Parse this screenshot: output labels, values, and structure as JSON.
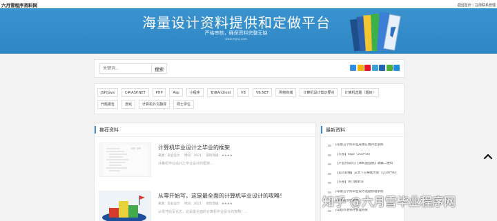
{
  "topbar": {
    "logo": "六月雪程序资料网",
    "links": [
      "返回首页",
      "在线联系管理"
    ]
  },
  "banner": {
    "title": "海量设计资料提供和定做平台",
    "subtitle": "严格审核，确保资料完整无缺",
    "url": "www.mylxj.com"
  },
  "search": {
    "placeholder": "关键词...",
    "button": "搜索"
  },
  "share_icons": [
    "plus-icon",
    "qzone-icon",
    "weibo-icon",
    "tencent-weibo-icon",
    "renren-icon",
    "wechat-icon",
    "qq-icon"
  ],
  "tags": [
    "JSP/Java",
    "C#/ASP.NET",
    "PHP",
    "Asp",
    "小程序",
    "安卓Android",
    "VB",
    "VB.NET",
    "购物商城",
    "计算机设计知识要点",
    "计算机选题（题目）",
    "开题报告",
    "游戏",
    "计算机外文翻译",
    "硕士学位"
  ],
  "recommend": {
    "title": "推荐资料",
    "articles": [
      {
        "title": "计算机毕业设计之毕业的框架",
        "meta": [
          "来源：毕业设计",
          "时间：2021",
          "资料等级：★★★★"
        ],
        "desc": "计算机毕业设计之毕业设计的框架..."
      },
      {
        "title": "从零开始写，这是最全面的计算机毕业设计的攻略！",
        "meta": [
          "来源：毕业设计",
          "时间：2021",
          "资料等级：★★★★"
        ],
        "desc": "从零开始写论文，这是最全面的计算机毕业设计的攻略！..."
      }
    ]
  },
  "latest": {
    "title": "最新资料",
    "items": [
      "jsp留言学院毕业成绩在线评定系统",
      "【头部】logo（250*50）",
      "【产品内容页】【本机画面图】收藏二维码",
      "【首页轮播】正文下方横幅大图（1100*90）",
      "【头部】热门搜索词",
      "jsp留言学院毕业设计选题管理系统",
      "jsp会员管理系统",
      "jsp超市进销存管理系统"
    ]
  },
  "watermark": "知乎 @六月雪毕业程序网",
  "colors": {
    "banner": "#2f86c4",
    "accent": "#3a8ed0",
    "background": "#f3f3f3"
  }
}
